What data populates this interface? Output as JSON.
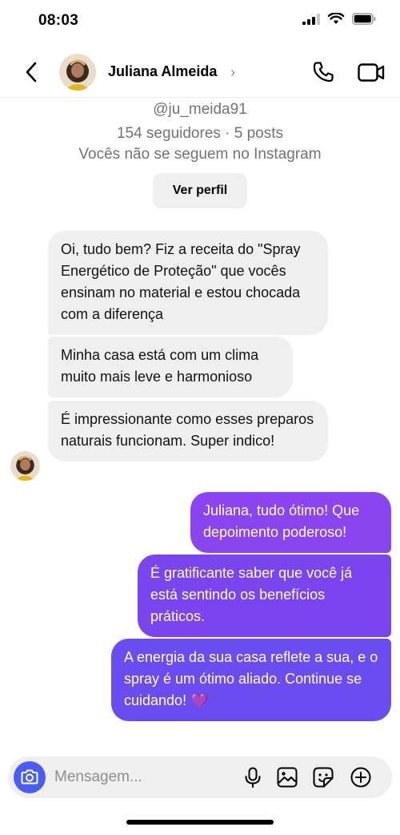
{
  "status_bar": {
    "time": "08:03"
  },
  "header": {
    "contact_name": "Juliana Almeida",
    "chevron": "›"
  },
  "profile": {
    "handle": "@ju_meida91",
    "stats": "154 seguidores · 5 posts",
    "follow_note": "Vocês não se seguem no Instagram",
    "view_profile_label": "Ver perfil"
  },
  "messages": {
    "incoming": [
      {
        "text": "Oi, tudo bem? Fiz a receita do \"Spray Energético de Proteção\" que vocês ensinam no material e estou chocada com a diferença"
      },
      {
        "text": "Minha casa está com um clima muito mais leve e harmonioso"
      },
      {
        "text": "É impressionante como esses preparos naturais funcionam. Super indico!"
      }
    ],
    "outgoing": [
      {
        "text": "Juliana, tudo ótimo! Que depoimento poderoso!"
      },
      {
        "text": " É gratificante saber que você já está sentindo os benefícios práticos."
      },
      {
        "text": "A energia da sua casa reflete a sua, e o spray é um ótimo aliado. Continue se cuidando! 💜"
      }
    ]
  },
  "composer": {
    "placeholder": "Mensagem..."
  },
  "colors": {
    "accent_blue": "#4a5cf2",
    "outgoing_1": "#8a44f0",
    "outgoing_2": "#7a45ee",
    "outgoing_3": "#6a4cf0",
    "incoming_bg": "#efefef"
  },
  "icons": {
    "back": "chevron-left-icon",
    "call": "phone-icon",
    "video": "video-camera-icon",
    "camera": "camera-icon",
    "mic": "microphone-icon",
    "gallery": "image-icon",
    "sticker": "sticker-icon",
    "plus": "plus-circle-icon"
  }
}
